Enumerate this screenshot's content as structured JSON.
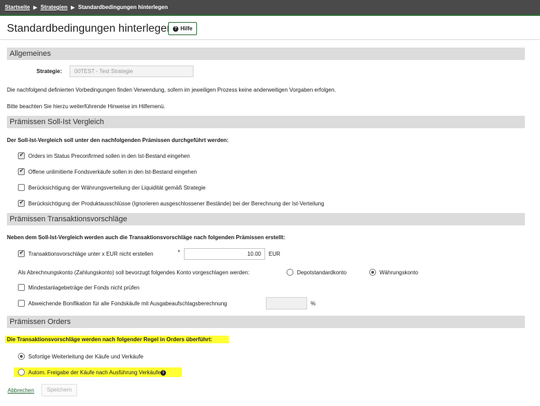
{
  "breadcrumb": {
    "items": [
      "Startseite",
      "Strategien",
      "Standardbedingungen hinterlegen"
    ]
  },
  "page": {
    "title": "Standardbedingungen hinterlegen",
    "help_label": "Hilfe"
  },
  "allgemeines": {
    "heading": "Allgemeines",
    "strategie_label": "Strategie:",
    "strategie_value": "00TEST - Test Strategie",
    "info_text_1": "Die nachfolgend definierten Vorbedingungen finden Verwendung, sofern im jeweiligen Prozess keine anderweitigen Vorgaben erfolgen.",
    "info_text_2": "Bitte beachten Sie hierzu weiterführende Hinweise im Hilfemenü."
  },
  "soll_ist": {
    "heading": "Prämissen Soll-Ist Vergleich",
    "intro": "Der Soll-Ist-Vergleich soll unter den nachfolgenden Prämissen durchgeführt werden:",
    "options": [
      {
        "label": "Orders im Status Preconfirmed sollen in den Ist-Bestand eingehen",
        "checked": true
      },
      {
        "label": "Offene unlimitierte Fondsverkäufe sollen in den Ist-Bestand eingehen",
        "checked": true
      },
      {
        "label": "Berücksichtigung der Währungsverteilung der Liquidität gemäß Strategie",
        "checked": false
      },
      {
        "label": "Berücksichtigung der Produktausschlüsse (Ignorieren ausgeschlossener Bestände) bei der Berechnung der Ist-Verteilung",
        "checked": true
      }
    ]
  },
  "transaktion": {
    "heading": "Prämissen Transaktionsvorschläge",
    "intro": "Neben dem Soll-Ist-Vergleich werden auch die Transaktionsvorschläge nach folgenden Prämissen erstellt:",
    "min_amount": {
      "label": "Transaktionsvorschläge unter x EUR nicht erstellen",
      "checked": true,
      "required_mark": "*",
      "value": "10.00",
      "unit": "EUR"
    },
    "account": {
      "label": "Als Abrechnungskonto (Zahlungskonto) soll bevorzugt folgendes Konto vorgeschlagen werden:",
      "option_1": "Depotstandardkonto",
      "option_2": "Währungskonto",
      "selected": "Währungskonto"
    },
    "min_fonds": {
      "label": "Mindestanlagebeträge der Fonds nicht prüfen",
      "checked": false
    },
    "bonifikation": {
      "label": "Abweichende Bonifikation für alle Fondskäufe mit Ausgabeaufschlagsberechnung",
      "checked": false,
      "value": "",
      "unit": "%"
    }
  },
  "orders": {
    "heading": "Prämissen Orders",
    "intro": "Die Transaktionsvorschläge werden nach folgender Regel in Orders überführt:",
    "option_1": "Sofortige Weiterleitung der Käufe und Verkäufe",
    "option_2": "Autom. Freigabe der Käufe nach Ausführung Verkäufe",
    "selected": "Sofortige Weiterleitung der Käufe und Verkäufe",
    "highlight_color": "#ffff33"
  },
  "actions": {
    "cancel_label": "Abbrechen",
    "save_label": "Speichern"
  },
  "colors": {
    "topbar": "#4a4a4a",
    "accent": "#2e6b3a",
    "section_bg": "#dcdcdc"
  }
}
